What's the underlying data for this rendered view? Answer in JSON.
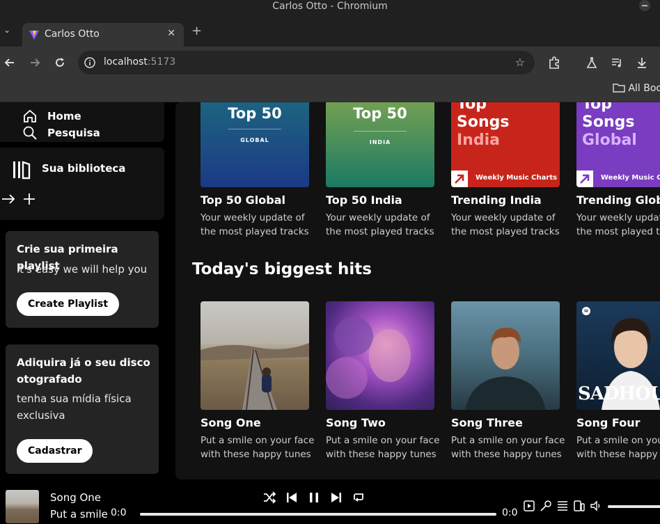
{
  "window": {
    "title": "Carlos Otto - Chromium"
  },
  "browser": {
    "tab_title": "Carlos Otto",
    "url_host": "localhost",
    "url_port": ":5173",
    "bookmarks_label": "All Boo"
  },
  "sidebar": {
    "home": "Home",
    "search": "Pesquisa",
    "library": "Sua biblioteca",
    "playlist_card": {
      "heading": "Crie sua primeira playlist",
      "sub": "it's easy we will help you",
      "button": "Create Playlist"
    },
    "disc_card": {
      "heading_1": "Adiquira já o seu disco",
      "heading_2": "otografado",
      "sub_1": "tenha sua mídia física",
      "sub_2": "exclusiva",
      "button": "Cadastrar"
    }
  },
  "charts_row": [
    {
      "title": "Top 50 Global",
      "desc_1": "Your weekly update of",
      "desc_2": "the most played tracks",
      "art_big": "Top 50",
      "art_small": "GLOBAL"
    },
    {
      "title": "Top 50 India",
      "desc_1": "Your weekly update of",
      "desc_2": "the most played tracks",
      "art_big": "Top 50",
      "art_small": "INDIA"
    },
    {
      "title": "Trending India",
      "desc_1": "Your weekly update of",
      "desc_2": "the most played tracks",
      "art_l1": "Top",
      "art_l2": "Songs",
      "art_l3": "India",
      "art_tag": "Weekly Music Charts"
    },
    {
      "title": "Trending Global",
      "desc_1": "Your weekly update of",
      "desc_2": "the most played tra",
      "art_l1": "Top",
      "art_l2": "Songs",
      "art_l3": "Global",
      "art_tag": "Weekly Music C"
    }
  ],
  "hits_section": {
    "title": "Today's biggest hits"
  },
  "hits_row": [
    {
      "title": "Song One",
      "desc_1": "Put a smile on your face",
      "desc_2": "with these happy tunes"
    },
    {
      "title": "Song Two",
      "desc_1": "Put a smile on your face",
      "desc_2": "with these happy tunes"
    },
    {
      "title": "Song Three",
      "desc_1": "Put a smile on your face",
      "desc_2": "with these happy tunes"
    },
    {
      "title": "Song Four",
      "desc_1": "Put a smile on your",
      "desc_2": "with these happy tu",
      "art_text": "SADHOU"
    }
  ],
  "player": {
    "track": "Song One",
    "artist": "Put a smile",
    "time_current": "0:0",
    "time_total": "0:0"
  },
  "colors": {
    "brand_green": "#1db954",
    "background": "#000000",
    "panel": "#121212",
    "card": "#242424"
  }
}
